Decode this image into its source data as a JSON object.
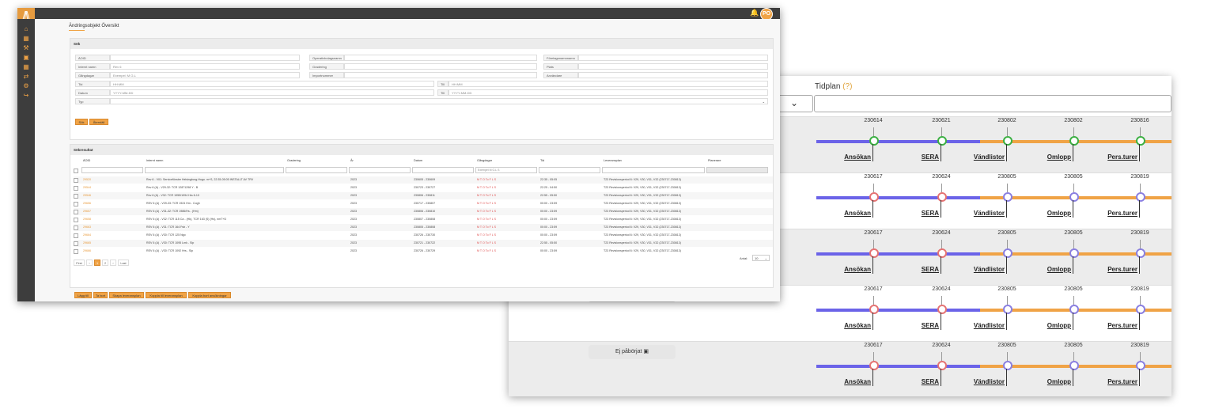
{
  "timeline_window": {
    "title": "Tidplan",
    "title_help": "(?)",
    "phase_labels": [
      "Ansökan",
      "SERA",
      "Vändlistor",
      "Omlopp",
      "Pers.turer"
    ],
    "rows": [
      {
        "dates": [
          "230614",
          "230621",
          "230802",
          "230802",
          "230816"
        ],
        "status": "done",
        "background": "alt"
      },
      {
        "dates": [
          "230617",
          "230624",
          "230805",
          "230805",
          "230819"
        ],
        "status": "mixed",
        "background": "white"
      },
      {
        "dates": [
          "230617",
          "230624",
          "230805",
          "230805",
          "230819"
        ],
        "status": "mixed",
        "background": "alt"
      },
      {
        "dates": [
          "230617",
          "230624",
          "230805",
          "230805",
          "230819"
        ],
        "status": "mixed",
        "background": "white"
      },
      {
        "dates": [
          "230617",
          "230624",
          "230805",
          "230805",
          "230819"
        ],
        "status": "mixed",
        "background": "alt"
      }
    ],
    "not_started_label": "Ej påbörjat",
    "colors": {
      "blue": "#6b63e8",
      "orange": "#f0a346",
      "green": "#3cb043",
      "red": "#e57373",
      "violet": "#8a7fe0"
    }
  },
  "main_window": {
    "user_initials": "PO",
    "page_title": "Ändringsobjekt Översikt",
    "search_panel": {
      "header": "Sök",
      "fields": {
        "aoid": "ÄOID",
        "operational_name": "Operativbolagsnamn",
        "company_name": "Företagsnamnnamn",
        "internal_name": "Internt namn",
        "internal_name_value": "Rev 6",
        "gradering": "Gradering",
        "plats": "Plats",
        "gangdagar": "Gångdagar",
        "gangdagar_placeholder": "Exempel: M O-L",
        "importnummer": "Importnummer",
        "anvandare": "Användare",
        "tid": "Tid",
        "tid_placeholder": "HH:MM",
        "till": "Till",
        "till_placeholder": "HH:MM",
        "datum": "Datum",
        "datum_placeholder": "YYYY-MM-DD",
        "till2": "Till",
        "till2_placeholder": "YYYY-MM-DD",
        "typ": "Typ"
      },
      "search_button": "Sök",
      "reset_button": "Återställ"
    },
    "results_panel": {
      "header": "Sökresultat",
      "columns": [
        "ÄOID",
        "Internt namn",
        "Gradering",
        "År",
        "Datum",
        "Gångdagar",
        "Tid",
        "Leveransplan",
        "Planerare"
      ],
      "gangdagar_filter_placeholder": "Exempel M O-L S",
      "rows": [
        {
          "id": "29520",
          "name": "Rev 6 - V01: Servicefönster Helsingborg-Hogo. m+S, 22:35-05:05 INSTALLT AV TRV",
          "year": "2023",
          "date": "230605 - 230609",
          "days": "M T O To F L S",
          "time": "22:35 - 05:05",
          "plan": "T23 Revisionsperiod 6: V29, V30, V31, V32 (230717-230813)"
        },
        {
          "id": "29544",
          "name": "Rev 6 (A) - V29-32: TCR 12871298 Y - B",
          "year": "2023",
          "date": "230723 - 230727",
          "days": "M T O To F L S",
          "time": "22:25 - 04:50",
          "plan": "T23 Revisionsperiod 6: V29, V30, V31, V32 (230717-230813)"
        },
        {
          "id": "29546",
          "name": "Rev 6 (A) - V32: TCR 1955/1994 Hrs 6-10",
          "year": "2023",
          "date": "230806 - 230811",
          "days": "M T O To F L S",
          "time": "22:55 - 05:50",
          "plan": "T23 Revisionsperiod 6: V29, V30, V31, V32 (230717-230813)"
        },
        {
          "id": "29656",
          "name": "REV 6 (A) - V29-33: TCR 1924 Hm - Cogh",
          "year": "2023",
          "date": "230717 - 230807",
          "days": "M T O To F L S",
          "time": "00:00 - 23:59",
          "plan": "T23 Revisionsperiod 6: V29, V30, V31, V32 (230717-230813)"
        },
        {
          "id": "29657",
          "name": "REV 6 (A) - V31-32: TCR 1986/Hs - (Hm)",
          "year": "2023",
          "date": "230806 - 230810",
          "days": "M T O To F L S",
          "time": "00:00 - 23:59",
          "plan": "T23 Revisionsperiod 6: V29, V30, V31, V32 (230717-230813)"
        },
        {
          "id": "29658",
          "name": "REV 6 (A) - V32: TCR 115 Ca - (Hk), TCR 163 (S) (Hs), nmT+D",
          "year": "2023",
          "date": "230807 - 230808",
          "days": "M T O To F L S",
          "time": "00:00 - 23:59",
          "plan": "T23 Revisionsperiod 6: V29, V30, V31, V32 (230717-230813)"
        },
        {
          "id": "29663",
          "name": "REV 6 (A) - V31: TCR 164 Fsb - Y",
          "year": "2023",
          "date": "230805 - 230808",
          "days": "M T O To F L S",
          "time": "00:00 - 23:59",
          "plan": "T23 Revisionsperiod 6: V29, V30, V31, V32 (230717-230813)"
        },
        {
          "id": "29664",
          "name": "REV 6 (A) - V30: TCR 125 Ngo",
          "year": "2023",
          "date": "230726 - 230730",
          "days": "M T O To F L S",
          "time": "00:00 - 23:59",
          "plan": "T23 Revisionsperiod 6: V29, V30, V31, V32 (230717-230813)"
        },
        {
          "id": "29665",
          "name": "REV 6 (A) - V30: TCR 1095 Lmk - Sip",
          "year": "2023",
          "date": "230721 - 230722",
          "days": "M T O To F L S",
          "time": "22:55 - 05:50",
          "plan": "T23 Revisionsperiod 6: V29, V30, V31, V32 (230717-230813)"
        },
        {
          "id": "29666",
          "name": "REV 6 (A) - V30: TCR 1092 Hrs - Sip",
          "year": "2023",
          "date": "230726 - 230729",
          "days": "M T O To F L S",
          "time": "00:00 - 23:59",
          "plan": "T23 Revisionsperiod 6: V29, V30, V31, V32 (230717-230813)"
        }
      ],
      "pagination": [
        "First",
        "‹",
        "1",
        "2",
        "›",
        "Last"
      ],
      "active_page": "1",
      "count_label": "Antal:",
      "count_value": "10"
    },
    "action_buttons": [
      "Lägg till",
      "Ta bort",
      "Skapa leveransplan",
      "Koppla till leveransplan",
      "Koppla bort ansökningar"
    ],
    "icons": [
      "logo-icon",
      "home-icon",
      "grid-icon",
      "wrench-icon",
      "briefcase-icon",
      "map-icon",
      "arrows-icon",
      "gear-icon",
      "logout-icon",
      "bell-icon"
    ]
  }
}
